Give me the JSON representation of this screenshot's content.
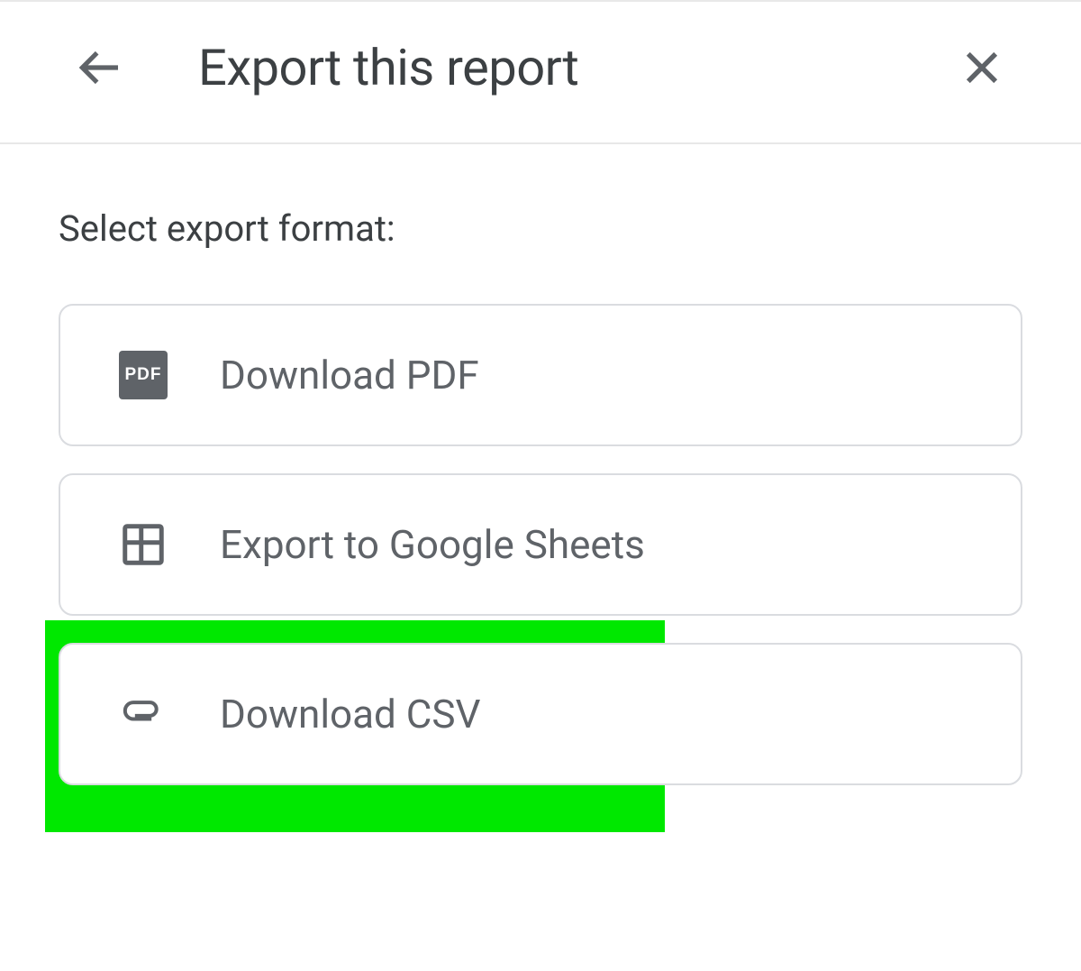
{
  "header": {
    "title": "Export this report"
  },
  "content": {
    "subtitle": "Select export format:",
    "options": [
      {
        "icon": "pdf",
        "label": "Download PDF"
      },
      {
        "icon": "sheets",
        "label": "Export to Google Sheets"
      },
      {
        "icon": "attachment",
        "label": "Download CSV"
      }
    ]
  }
}
